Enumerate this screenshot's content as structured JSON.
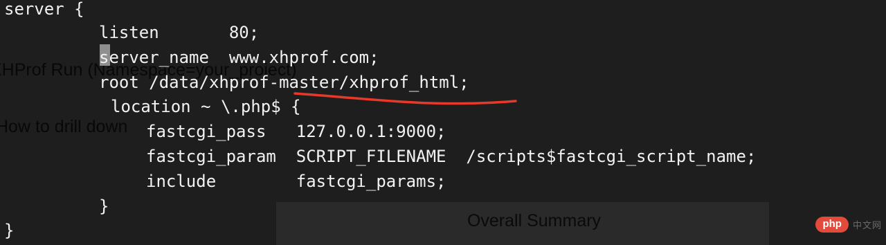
{
  "background_page": {
    "run_title": "XHProf Run (Namespace=your_project)",
    "drill_hint": "How to drill down",
    "summary_title": "Overall Summary"
  },
  "terminal": {
    "lines": [
      "server {",
      "listen       80;",
      "server_name  www.xhprof.com;",
      "root /data/xhprof-master/xhprof_html;",
      "location ~ \\.php$ {",
      "fastcgi_pass   127.0.0.1:9000;",
      "fastcgi_param  SCRIPT_FILENAME  /scripts$fastcgi_script_name;",
      "include        fastcgi_params;",
      "}",
      "}"
    ]
  },
  "annotation": {
    "underline_color": "#e8382a"
  },
  "watermark": {
    "badge": "php",
    "text": "中文网"
  }
}
